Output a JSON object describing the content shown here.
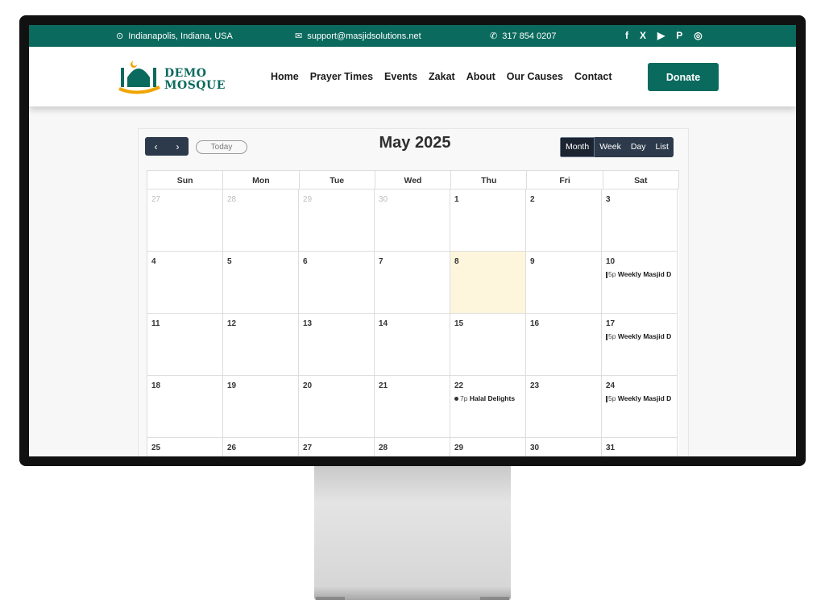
{
  "topbar": {
    "location": "Indianapolis, Indiana, USA",
    "email": "support@masjidsolutions.net",
    "phone": "317 854 0207",
    "social": [
      "f",
      "X",
      "▶",
      "P",
      "◎"
    ]
  },
  "header": {
    "logo_line1": "DEMO",
    "logo_line2": "MOSQUE",
    "nav": [
      "Home",
      "Prayer Times",
      "Events",
      "Zakat",
      "About",
      "Our Causes",
      "Contact"
    ],
    "donate_label": "Donate"
  },
  "calendar": {
    "title": "May 2025",
    "today_label": "Today",
    "prev_icon": "‹",
    "next_icon": "›",
    "views": [
      "Month",
      "Week",
      "Day",
      "List"
    ],
    "active_view": "Month",
    "days_of_week": [
      "Sun",
      "Mon",
      "Tue",
      "Wed",
      "Thu",
      "Fri",
      "Sat"
    ],
    "weeks": [
      [
        {
          "d": "27",
          "other": true
        },
        {
          "d": "28",
          "other": true
        },
        {
          "d": "29",
          "other": true
        },
        {
          "d": "30",
          "other": true
        },
        {
          "d": "1"
        },
        {
          "d": "2"
        },
        {
          "d": "3"
        }
      ],
      [
        {
          "d": "4"
        },
        {
          "d": "5"
        },
        {
          "d": "6"
        },
        {
          "d": "7"
        },
        {
          "d": "8",
          "today": true
        },
        {
          "d": "9"
        },
        {
          "d": "10",
          "event": {
            "time": "5p",
            "title": "Weekly Masjid D",
            "bar": true
          }
        }
      ],
      [
        {
          "d": "11"
        },
        {
          "d": "12"
        },
        {
          "d": "13"
        },
        {
          "d": "14"
        },
        {
          "d": "15"
        },
        {
          "d": "16"
        },
        {
          "d": "17",
          "event": {
            "time": "5p",
            "title": "Weekly Masjid D",
            "bar": true
          }
        }
      ],
      [
        {
          "d": "18"
        },
        {
          "d": "19"
        },
        {
          "d": "20"
        },
        {
          "d": "21"
        },
        {
          "d": "22",
          "event": {
            "time": "7p",
            "title": "Halal Delights",
            "dot": true
          }
        },
        {
          "d": "23"
        },
        {
          "d": "24",
          "event": {
            "time": "5p",
            "title": "Weekly Masjid D",
            "bar": true
          }
        }
      ],
      [
        {
          "d": "25"
        },
        {
          "d": "26"
        },
        {
          "d": "27"
        },
        {
          "d": "28"
        },
        {
          "d": "29"
        },
        {
          "d": "30"
        },
        {
          "d": "31"
        }
      ]
    ]
  }
}
